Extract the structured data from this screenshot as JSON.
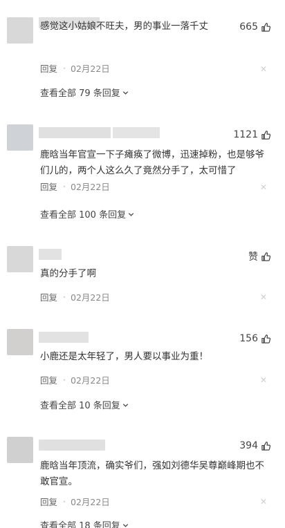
{
  "comments": [
    {
      "likes": "665",
      "text": "感觉这小姑娘不旺夫，男的事业一落千丈",
      "reply_label": "回复",
      "date": "02月22日",
      "view_replies": "查看全部 79 条回复"
    },
    {
      "likes": "1121",
      "text": "鹿晗当年官宣一下子瘫痪了微博，迅速掉粉，也是够爷们儿的，两个人这么久了竟然分手了，太可惜了",
      "reply_label": "回复",
      "date": "02月22日",
      "view_replies": "查看全部 100 条回复"
    },
    {
      "likes": "赞",
      "text": "真的分手了啊",
      "reply_label": "回复",
      "date": "02月22日",
      "view_replies": ""
    },
    {
      "likes": "156",
      "text": "小鹿还是太年轻了，男人要以事业为重！",
      "reply_label": "回复",
      "date": "02月22日",
      "view_replies": "查看全部 10 条回复"
    },
    {
      "likes": "394",
      "text": "鹿晗当年顶流，确实爷们，强如刘德华吴尊巅峰期也不敢官宣。",
      "reply_label": "回复",
      "date": "02月22日",
      "view_replies": "查看全部 18 条回复"
    }
  ],
  "icons": {
    "like": "thumbs-up-icon",
    "close": "close-icon",
    "expand": "chevron-down-icon"
  },
  "colors": {
    "text": "#333333",
    "meta": "#888888",
    "close": "#cfcfcf",
    "avatar": "#d6d6d6"
  }
}
